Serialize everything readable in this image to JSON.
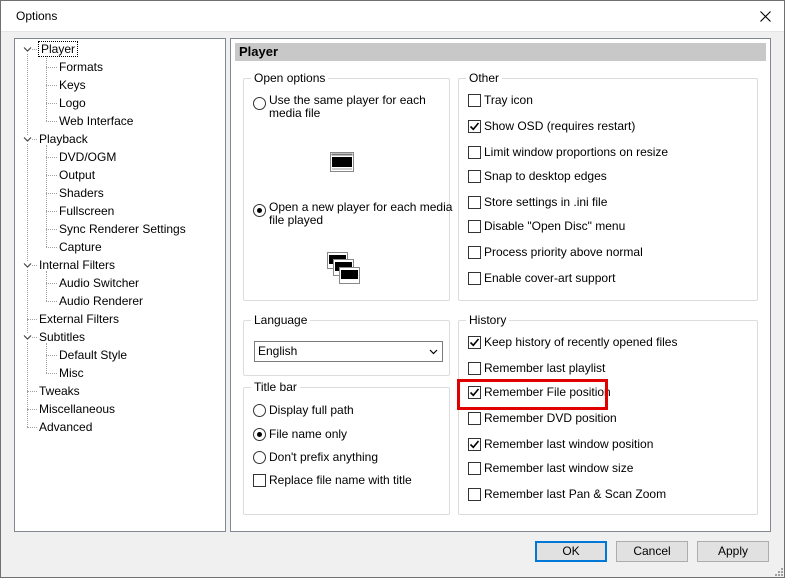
{
  "window": {
    "title": "Options"
  },
  "tree": {
    "items": [
      {
        "label": "Player",
        "level": 0,
        "expandable": true,
        "selected": true
      },
      {
        "label": "Formats",
        "level": 1
      },
      {
        "label": "Keys",
        "level": 1
      },
      {
        "label": "Logo",
        "level": 1
      },
      {
        "label": "Web Interface",
        "level": 1
      },
      {
        "label": "Playback",
        "level": 0,
        "expandable": true
      },
      {
        "label": "DVD/OGM",
        "level": 1
      },
      {
        "label": "Output",
        "level": 1
      },
      {
        "label": "Shaders",
        "level": 1
      },
      {
        "label": "Fullscreen",
        "level": 1
      },
      {
        "label": "Sync Renderer Settings",
        "level": 1
      },
      {
        "label": "Capture",
        "level": 1
      },
      {
        "label": "Internal Filters",
        "level": 0,
        "expandable": true
      },
      {
        "label": "Audio Switcher",
        "level": 1
      },
      {
        "label": "Audio Renderer",
        "level": 1
      },
      {
        "label": "External Filters",
        "level": 0
      },
      {
        "label": "Subtitles",
        "level": 0,
        "expandable": true
      },
      {
        "label": "Default Style",
        "level": 1
      },
      {
        "label": "Misc",
        "level": 1
      },
      {
        "label": "Tweaks",
        "level": 0
      },
      {
        "label": "Miscellaneous",
        "level": 0
      },
      {
        "label": "Advanced",
        "level": 0
      }
    ]
  },
  "page": {
    "header": "Player",
    "open_options": {
      "title": "Open options",
      "same_player": "Use the same player for each media file",
      "new_player": "Open a new player for each media file played",
      "selected": "new_player"
    },
    "language": {
      "title": "Language",
      "value": "English"
    },
    "title_bar": {
      "title": "Title bar",
      "options": [
        {
          "label": "Display full path",
          "checked": false
        },
        {
          "label": "File name only",
          "checked": true
        },
        {
          "label": "Don't prefix anything",
          "checked": false
        }
      ],
      "replace_label": "Replace file name with title",
      "replace_checked": false
    },
    "other": {
      "title": "Other",
      "items": [
        {
          "label": "Tray icon",
          "checked": false
        },
        {
          "label": "Show OSD (requires restart)",
          "checked": true
        },
        {
          "label": "Limit window proportions on resize",
          "checked": false
        },
        {
          "label": "Snap to desktop edges",
          "checked": false
        },
        {
          "label": "Store settings in .ini file",
          "checked": false
        },
        {
          "label": "Disable \"Open Disc\" menu",
          "checked": false
        },
        {
          "label": "Process priority above normal",
          "checked": false
        },
        {
          "label": "Enable cover-art support",
          "checked": false
        }
      ]
    },
    "history": {
      "title": "History",
      "items": [
        {
          "label": "Keep history of recently opened files",
          "checked": true
        },
        {
          "label": "Remember last playlist",
          "checked": false
        },
        {
          "label": "Remember File position",
          "checked": true,
          "highlighted": true
        },
        {
          "label": "Remember DVD position",
          "checked": false
        },
        {
          "label": "Remember last window position",
          "checked": true
        },
        {
          "label": "Remember last window size",
          "checked": false
        },
        {
          "label": "Remember last Pan & Scan Zoom",
          "checked": false
        }
      ]
    }
  },
  "buttons": {
    "ok": "OK",
    "cancel": "Cancel",
    "apply": "Apply"
  },
  "colors": {
    "highlight": "#e00000",
    "accent": "#0078d7",
    "header_bg": "#c8c8c8"
  }
}
